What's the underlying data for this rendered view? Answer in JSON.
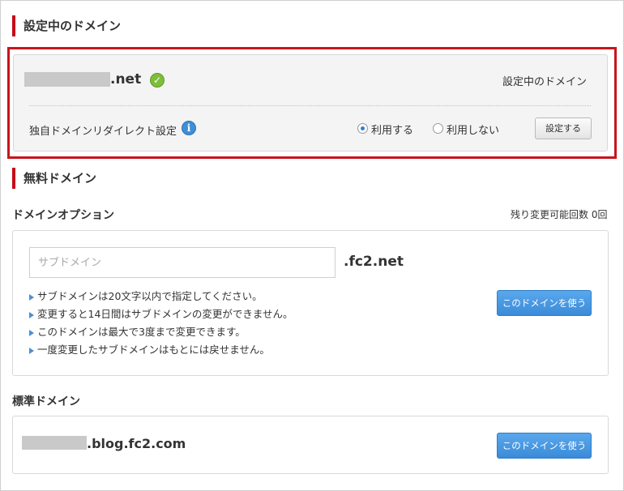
{
  "current_section": {
    "title": "設定中のドメイン",
    "domain_suffix": ".net",
    "status_text": "設定中のドメイン",
    "redirect_label": "独自ドメインリダイレクト設定",
    "radio_use_label": "利用する",
    "radio_not_use_label": "利用しない",
    "radio_selected": "利用する",
    "set_button_label": "設定する"
  },
  "free_section": {
    "title": "無料ドメイン",
    "option_heading": "ドメインオプション",
    "remaining_changes": "残り変更可能回数 0回",
    "input_placeholder": "サブドメイン",
    "input_value": "",
    "domain_suffix": ".fc2.net",
    "notes": [
      "サブドメインは20文字以内で指定してください。",
      "変更すると14日間はサブドメインの変更ができません。",
      "このドメインは最大で3度まで変更できます。",
      "一度変更したサブドメインはもとには戻せません。"
    ],
    "use_button_label": "このドメインを使う"
  },
  "standard_section": {
    "heading": "標準ドメイン",
    "domain_suffix": ".blog.fc2.com",
    "use_button_label": "このドメインを使う"
  },
  "colors": {
    "accent_red": "#c40d19",
    "button_blue": "#3a8bd9",
    "check_green": "#7fbe3a",
    "info_blue": "#3e8fd6"
  }
}
